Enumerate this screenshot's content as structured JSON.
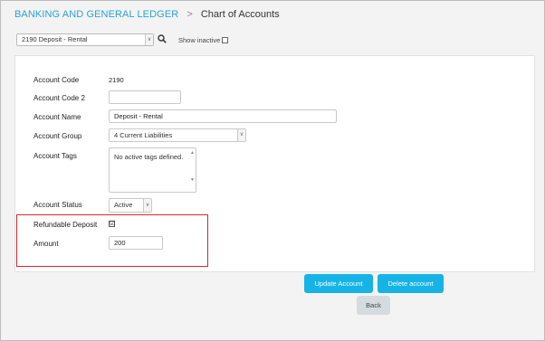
{
  "breadcrumb": {
    "module": "BANKING AND GENERAL LEDGER",
    "separator": ">",
    "page": "Chart of Accounts"
  },
  "account_selector": {
    "value": "2190    Deposit - Rental",
    "caret": "v"
  },
  "show_inactive_label": "Show inactive",
  "form": {
    "account_code": {
      "label": "Account Code",
      "value": "2190"
    },
    "account_code_2": {
      "label": "Account Code 2",
      "value": ""
    },
    "account_name": {
      "label": "Account Name",
      "value": "Deposit - Rental"
    },
    "account_group": {
      "label": "Account Group",
      "value": "4    Current Liabilities"
    },
    "account_tags": {
      "label": "Account Tags",
      "value": "No active tags defined."
    },
    "account_status": {
      "label": "Account Status",
      "value": "Active"
    },
    "refundable_deposit": {
      "label": "Refundable Deposit",
      "checked": true,
      "mark": "☑"
    },
    "amount": {
      "label": "Amount",
      "value": "200"
    }
  },
  "buttons": {
    "update": "Update Account",
    "delete": "Delete account",
    "back": "Back"
  },
  "colors": {
    "accent": "#16b4e6",
    "breadcrumb": "#2aa3d6",
    "highlight": "#d9282f"
  }
}
